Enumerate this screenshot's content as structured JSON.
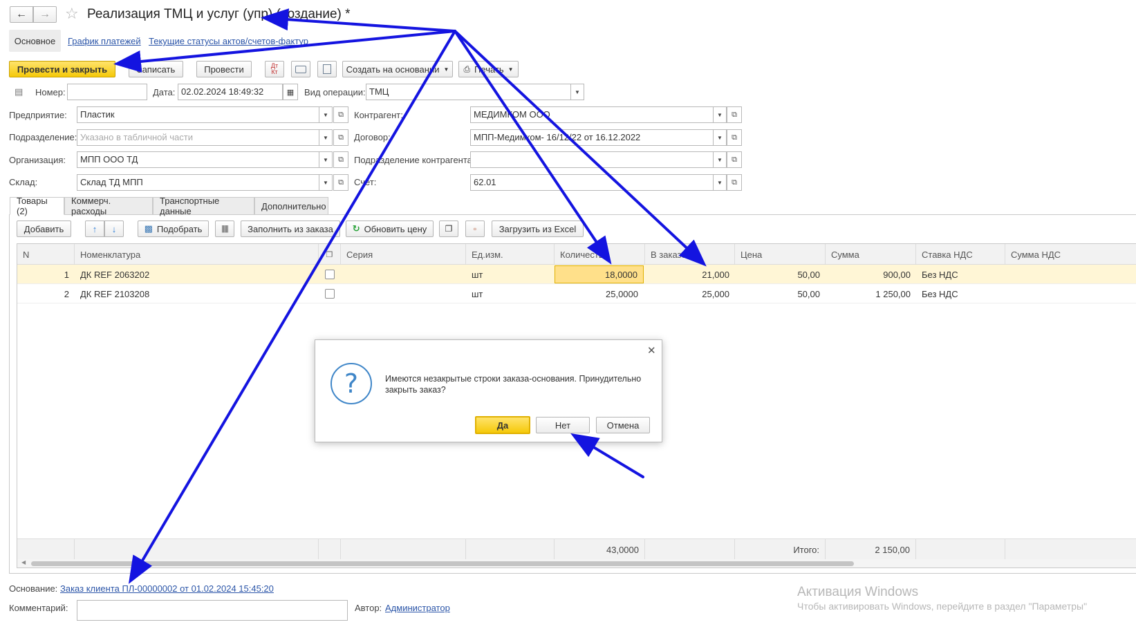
{
  "window": {
    "title": "Реализация ТМЦ и услуг (упр) (создание) *",
    "nav_back_icon": "arrow-left-icon",
    "nav_forward_icon": "arrow-right-icon",
    "favorite_icon": "star-icon"
  },
  "section_tabs": [
    {
      "label": "Основное",
      "active": true
    },
    {
      "label": "График платежей",
      "active": false
    },
    {
      "label": "Текущие статусы актов/счетов-фактур",
      "active": false
    }
  ],
  "toolbar": {
    "post_and_close": "Провести и закрыть",
    "save": "Записать",
    "post": "Провести",
    "create_based_on": "Создать на основании",
    "print": "Печать"
  },
  "form": {
    "number_label": "Номер:",
    "number_value": "",
    "date_label": "Дата:",
    "date_value": "02.02.2024 18:49:32",
    "operation_label": "Вид операции:",
    "operation_value": "ТМЦ",
    "enterprise_label": "Предприятие:",
    "enterprise_value": "Пластик",
    "division_label": "Подразделение:",
    "division_placeholder": "Указано в табличной части",
    "organization_label": "Организация:",
    "organization_value": "МПП ООО ТД",
    "warehouse_label": "Склад:",
    "warehouse_value": "Склад ТД МПП",
    "counterparty_label": "Контрагент:",
    "counterparty_value": "МЕДИМКОМ ООО",
    "contract_label": "Договор:",
    "contract_value": "МПП-Медимком- 16/12/22 от 16.12.2022",
    "cp_division_label": "Подразделение контрагента:",
    "cp_division_value": "",
    "account_label": "Счет:",
    "account_value": "62.01"
  },
  "doc_tabs": [
    {
      "label": "Товары (2)",
      "active": true
    },
    {
      "label": "Коммерч. расходы",
      "active": false
    },
    {
      "label": "Транспортные данные",
      "active": false
    },
    {
      "label": "Дополнительно",
      "active": false
    }
  ],
  "table_toolbar": {
    "add": "Добавить",
    "pick": "Подобрать",
    "fill_from_order": "Заполнить из заказа",
    "update_price": "Обновить цену",
    "load_excel": "Загрузить из Excel"
  },
  "table": {
    "columns": [
      "N",
      "Номенклатура",
      "",
      "Серия",
      "Ед.изм.",
      "Количество",
      "В заказе",
      "Цена",
      "Сумма",
      "Ставка НДС",
      "Сумма НДС"
    ],
    "rows": [
      {
        "n": "1",
        "item": "ДК REF 2063202",
        "series": "",
        "unit": "шт",
        "qty": "18,0000",
        "in_order": "21,000",
        "price": "50,00",
        "sum": "900,00",
        "vat_rate": "Без НДС",
        "vat_sum": ""
      },
      {
        "n": "2",
        "item": "ДК REF 2103208",
        "series": "",
        "unit": "шт",
        "qty": "25,0000",
        "in_order": "25,000",
        "price": "50,00",
        "sum": "1 250,00",
        "vat_rate": "Без НДС",
        "vat_sum": ""
      }
    ],
    "footer": {
      "qty_total": "43,0000",
      "total_label": "Итого:",
      "sum_total": "2 150,00"
    }
  },
  "footer": {
    "basis_label": "Основание:",
    "basis_link": "Заказ клиента ПЛ-00000002 от 01.02.2024 15:45:20",
    "comment_label": "Комментарий:",
    "author_label": "Автор:",
    "author_value": "Администратор"
  },
  "dialog": {
    "message": "Имеются незакрытые строки заказа-основания. Принудительно закрыть заказ?",
    "yes": "Да",
    "no": "Нет",
    "cancel": "Отмена"
  },
  "watermark": {
    "title": "Активация Windows",
    "subtitle": "Чтобы активировать Windows, перейдите в раздел \"Параметры\""
  },
  "colors": {
    "accent_yellow": "#f5c90a",
    "row_highlight": "#fff6d6",
    "link_blue": "#2b55a8",
    "annotation_arrow": "#1414e0"
  }
}
